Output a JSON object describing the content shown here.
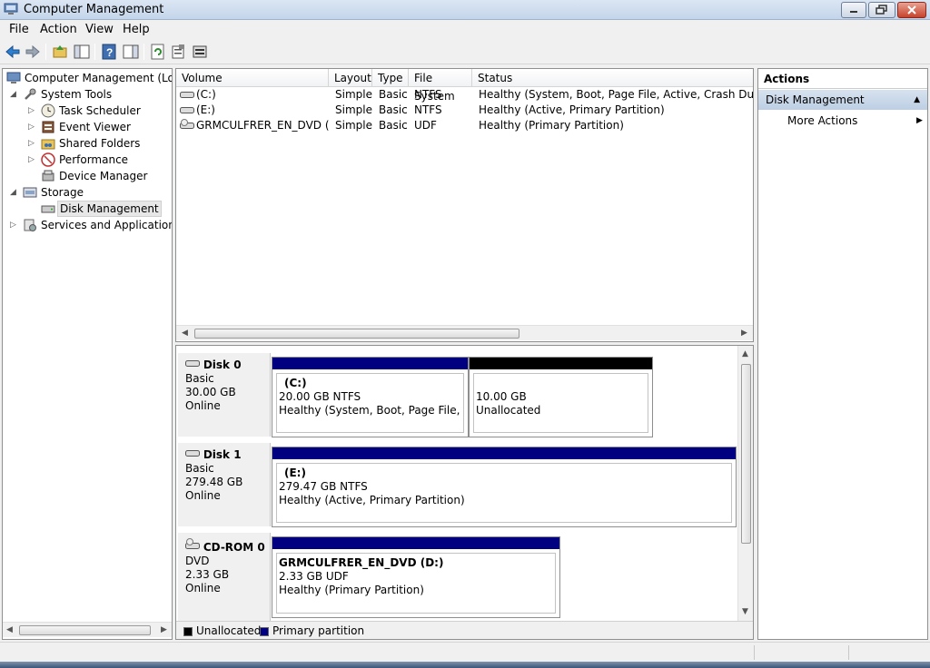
{
  "window": {
    "title": "Computer Management"
  },
  "menu": [
    "File",
    "Action",
    "View",
    "Help"
  ],
  "toolbar_icons": [
    "back-icon",
    "forward-icon",
    "up-folder-icon",
    "show-tree-icon",
    "help-icon",
    "show-action-pane-icon",
    "refresh-icon",
    "properties-icon",
    "disk-management-icon"
  ],
  "tree": {
    "items": [
      {
        "label": "Computer Management (Local",
        "icon": "computer-icon"
      },
      {
        "label": "System Tools",
        "icon": "tools-icon"
      },
      {
        "label": "Task Scheduler",
        "icon": "clock-icon"
      },
      {
        "label": "Event Viewer",
        "icon": "event-viewer-icon"
      },
      {
        "label": "Shared Folders",
        "icon": "shared-folder-icon"
      },
      {
        "label": "Performance",
        "icon": "performance-icon"
      },
      {
        "label": "Device Manager",
        "icon": "device-manager-icon"
      },
      {
        "label": "Storage",
        "icon": "storage-icon"
      },
      {
        "label": "Disk Management",
        "icon": "disk-icon"
      },
      {
        "label": "Services and Applications",
        "icon": "services-icon"
      }
    ]
  },
  "volumes": {
    "columns": [
      "Volume",
      "Layout",
      "Type",
      "File System",
      "Status"
    ],
    "rows": [
      {
        "volume": "(C:)",
        "layout": "Simple",
        "type": "Basic",
        "fs": "NTFS",
        "status": "Healthy (System, Boot, Page File, Active, Crash Dump, Pri"
      },
      {
        "volume": "(E:)",
        "layout": "Simple",
        "type": "Basic",
        "fs": "NTFS",
        "status": "Healthy (Active, Primary Partition)"
      },
      {
        "volume": "GRMCULFRER_EN_DVD (D:)",
        "layout": "Simple",
        "type": "Basic",
        "fs": "UDF",
        "status": "Healthy (Primary Partition)"
      }
    ]
  },
  "disks": [
    {
      "name": "Disk 0",
      "type": "Basic",
      "size": "30.00 GB",
      "state": "Online",
      "partitions": [
        {
          "name": "(C:)",
          "size": "20.00 GB NTFS",
          "status": "Healthy (System, Boot, Page File, Activ",
          "kind": "primary"
        },
        {
          "name": "",
          "size": "10.00 GB",
          "status": "Unallocated",
          "kind": "unallocated"
        }
      ]
    },
    {
      "name": "Disk 1",
      "type": "Basic",
      "size": "279.48 GB",
      "state": "Online",
      "partitions": [
        {
          "name": "(E:)",
          "size": "279.47 GB NTFS",
          "status": "Healthy (Active, Primary Partition)",
          "kind": "primary"
        }
      ]
    },
    {
      "name": "CD-ROM 0",
      "type": "DVD",
      "size": "2.33 GB",
      "state": "Online",
      "partitions": [
        {
          "name": "GRMCULFRER_EN_DVD  (D:)",
          "size": "2.33 GB UDF",
          "status": "Healthy (Primary Partition)",
          "kind": "primary"
        }
      ]
    }
  ],
  "legend": {
    "unallocated": "Unallocated",
    "primary": "Primary partition"
  },
  "actions": {
    "header": "Actions",
    "section": "Disk Management",
    "more": "More Actions"
  },
  "colors": {
    "primary": "#000080",
    "unallocated": "#000000",
    "section_bg": "#c9d7ea"
  }
}
